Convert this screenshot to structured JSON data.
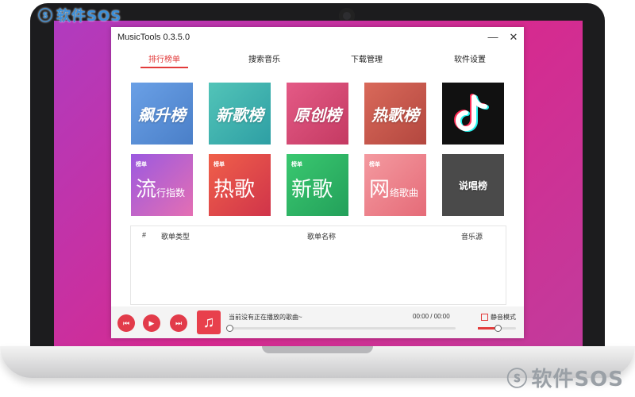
{
  "watermark": {
    "top": "软件SOS",
    "bottom": "软件SOS"
  },
  "window": {
    "title": "MusicTools 0.3.5.0",
    "minimize": "—",
    "close": "✕"
  },
  "tabs": [
    {
      "label": "排行榜单",
      "active": true
    },
    {
      "label": "搜索音乐",
      "active": false
    },
    {
      "label": "下载管理",
      "active": false
    },
    {
      "label": "软件设置",
      "active": false
    }
  ],
  "tiles_row1": [
    {
      "label": "飙升榜",
      "color": "#5b8fd6"
    },
    {
      "label": "新歌榜",
      "color": "#3fb6b0"
    },
    {
      "label": "原创榜",
      "color": "#d9476f"
    },
    {
      "label": "热歌榜",
      "color": "#c95a4e"
    },
    {
      "label": "",
      "icon": "tiktok-icon",
      "color": "#111111"
    }
  ],
  "tiles_row2": [
    {
      "small": "榜单",
      "big": "流",
      "rest": "行指数",
      "color": "#b45bd6"
    },
    {
      "small": "榜单",
      "big": "热歌",
      "rest": "",
      "color": "#e0454a"
    },
    {
      "small": "榜单",
      "big": "新歌",
      "rest": "",
      "color": "#3db66a"
    },
    {
      "small": "榜单",
      "big": "网",
      "rest": "络歌曲",
      "color": "#e98086"
    },
    {
      "label": "说唱榜",
      "color": "#4a4a4a"
    }
  ],
  "table": {
    "headers": [
      "#",
      "歌单类型",
      "歌单名称",
      "音乐源"
    ]
  },
  "player": {
    "now_playing": "当前没有正在播放的歌曲~",
    "time": "00:00 / 00:00",
    "mute_label": "静音模式",
    "progress": 0,
    "volume": 0.5,
    "prev_label": "⏮",
    "play_label": "▶",
    "next_label": "⏭",
    "cover_icon": "♫"
  }
}
